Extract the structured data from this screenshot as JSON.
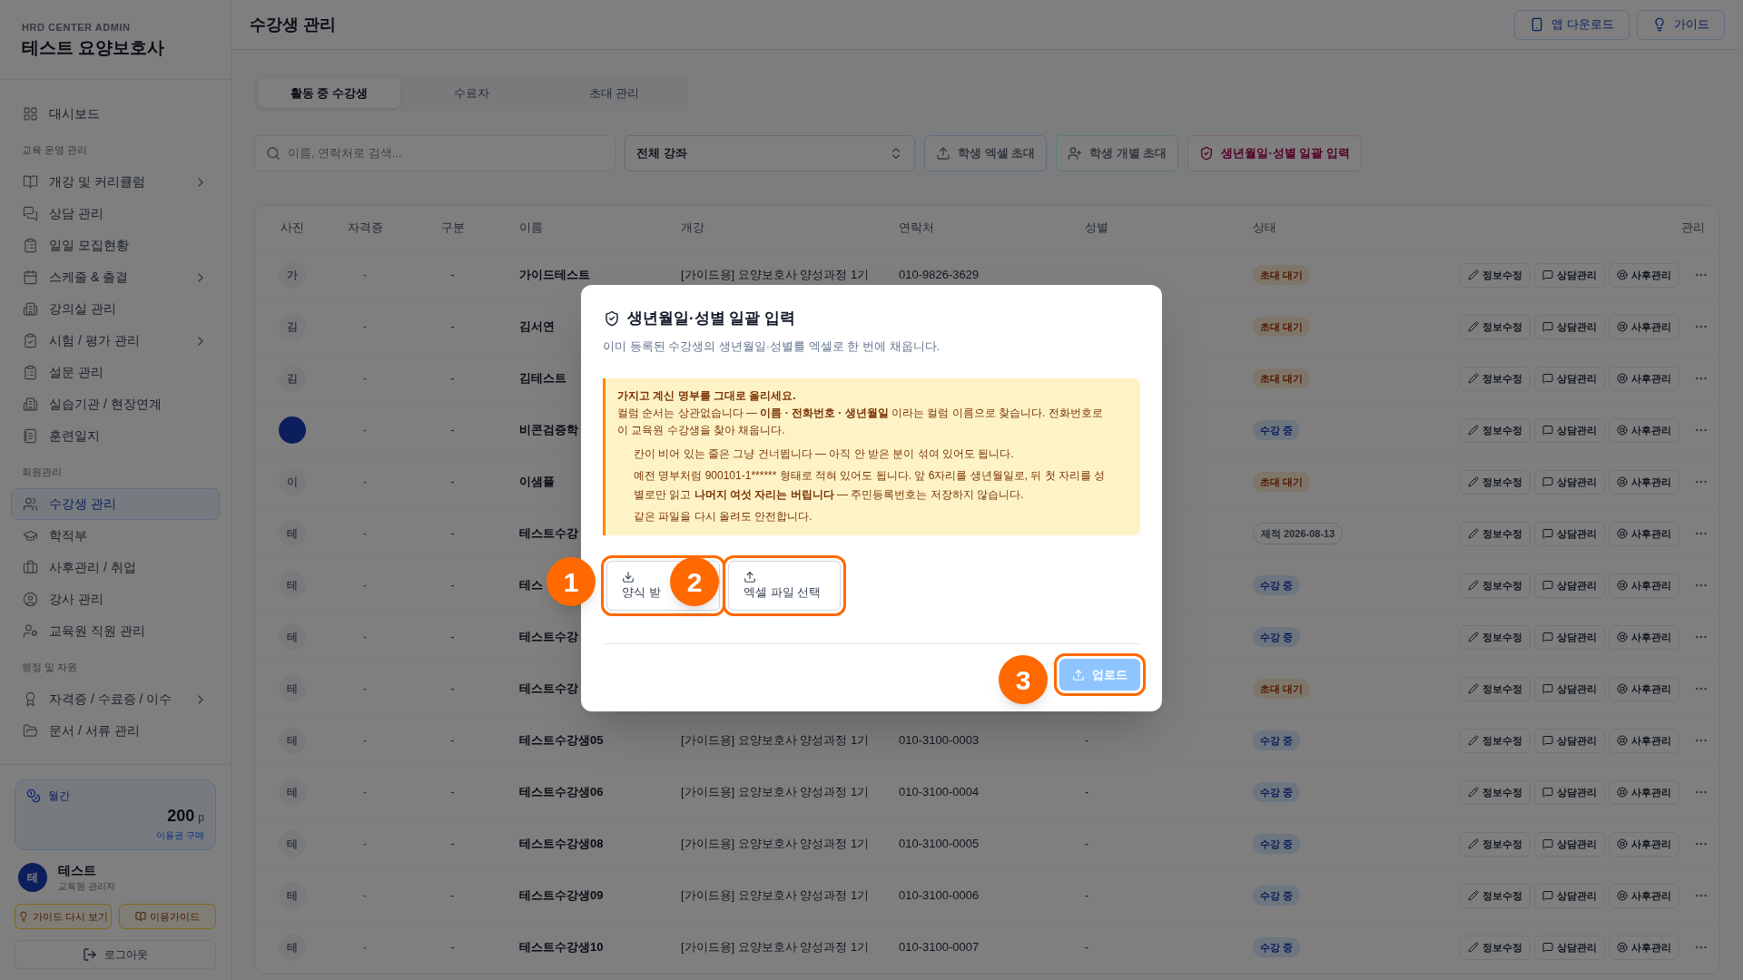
{
  "sidebar": {
    "brand_caption": "HRD CENTER ADMIN",
    "brand_title": "테스트 요양보호사",
    "sections": [
      {
        "items": [
          {
            "label": "대시보드",
            "expandable": false,
            "selected": false
          }
        ]
      },
      {
        "label": "교육 운영 관리",
        "items": [
          {
            "label": "개강 및 커리큘럼",
            "expandable": true,
            "selected": false
          },
          {
            "label": "상담 관리",
            "expandable": false,
            "selected": false
          },
          {
            "label": "일일 모집현황",
            "expandable": false,
            "selected": false
          },
          {
            "label": "스케줄 & 출결",
            "expandable": true,
            "selected": false
          },
          {
            "label": "강의실 관리",
            "expandable": false,
            "selected": false
          },
          {
            "label": "시험 / 평가 관리",
            "expandable": true,
            "selected": false
          },
          {
            "label": "설문 관리",
            "expandable": false,
            "selected": false
          },
          {
            "label": "실습기관 / 현장연계",
            "expandable": false,
            "selected": false
          },
          {
            "label": "훈련일지",
            "expandable": false,
            "selected": false
          }
        ]
      },
      {
        "label": "회원관리",
        "items": [
          {
            "label": "수강생 관리",
            "expandable": false,
            "selected": true
          },
          {
            "label": "학적부",
            "expandable": false,
            "selected": false
          },
          {
            "label": "사후관리 / 취업",
            "expandable": false,
            "selected": false
          },
          {
            "label": "강사 관리",
            "expandable": false,
            "selected": false
          },
          {
            "label": "교육원 직원 관리",
            "expandable": false,
            "selected": false
          }
        ]
      },
      {
        "label": "행정 및 자원",
        "items": [
          {
            "label": "자격증 / 수료증 / 이수",
            "expandable": true,
            "selected": false
          },
          {
            "label": "문서 / 서류 관리",
            "expandable": false,
            "selected": false
          }
        ]
      }
    ],
    "points": {
      "label": "월간",
      "amount": "200",
      "unit": "p",
      "link": "이용권 구매"
    },
    "user": {
      "initial": "테",
      "name": "테스트",
      "role": "교육원 관리자"
    },
    "guide_buttons": [
      "가이드 다시 보기",
      "이용가이드"
    ],
    "logout": "로그아웃"
  },
  "header": {
    "title": "수강생 관리",
    "buttons": [
      "앱 다운로드",
      "가이드"
    ]
  },
  "tabs": [
    {
      "label": "활동 중 수강생",
      "selected": true
    },
    {
      "label": "수료자",
      "selected": false
    },
    {
      "label": "초대 관리",
      "selected": false
    }
  ],
  "search": {
    "placeholder": "이름, 연락처로 검색..."
  },
  "course_select": {
    "value": "전체 강좌"
  },
  "toolbar_buttons": [
    {
      "label": "학생 엑셀 초대",
      "kind": "excel"
    },
    {
      "label": "학생 개별 초대",
      "kind": "single"
    },
    {
      "label": "생년월일·성별 일괄 입력",
      "kind": "bulk"
    }
  ],
  "table": {
    "columns": [
      "사진",
      "자격증",
      "구분",
      "이름",
      "개강",
      "연락처",
      "성별",
      "상태",
      "관리"
    ],
    "rows": [
      {
        "avatar": {
          "kind": "letter",
          "text": "가"
        },
        "license": "-",
        "type": "-",
        "name": "가이드테스트",
        "course": "[가이드용] 요양보호사 양성과정 1기",
        "phone": "010-9826-3629",
        "status": {
          "kind": "invited",
          "text": "초대 대기"
        },
        "actions": [
          "정보수정",
          "상담관리",
          "사후관리"
        ]
      },
      {
        "avatar": {
          "kind": "letter",
          "text": "김"
        },
        "license": "-",
        "type": "-",
        "name": "김서연",
        "status": {
          "kind": "invited",
          "text": "초대 대기"
        },
        "actions": [
          "정보수정",
          "상담관리",
          "사후관리"
        ]
      },
      {
        "avatar": {
          "kind": "letter",
          "text": "김"
        },
        "license": "-",
        "type": "-",
        "name": "김테스트",
        "status": {
          "kind": "invited",
          "text": "초대 대기"
        },
        "actions": [
          "정보수정",
          "상담관리",
          "사후관리"
        ]
      },
      {
        "avatar": {
          "kind": "photo"
        },
        "license": "-",
        "type": "-",
        "name": "비콘검증학",
        "status": {
          "kind": "active",
          "text": "수강 중"
        },
        "actions": [
          "정보수정",
          "상담관리",
          "사후관리"
        ]
      },
      {
        "avatar": {
          "kind": "letter",
          "text": "이"
        },
        "license": "-",
        "type": "-",
        "name": "이샘플",
        "status": {
          "kind": "invited",
          "text": "초대 대기"
        },
        "actions": [
          "정보수정",
          "상담관리",
          "사후관리"
        ]
      },
      {
        "avatar": {
          "kind": "letter",
          "text": "테"
        },
        "license": "-",
        "type": "-",
        "name": "테스트수강",
        "status": {
          "kind": "expelled",
          "text": "제적 2026-08-13"
        },
        "actions": [
          "정보수정",
          "상담관리",
          "사후관리"
        ]
      },
      {
        "avatar": {
          "kind": "letter",
          "text": "테"
        },
        "license": "-",
        "type": "-",
        "name": "테스",
        "status": {
          "kind": "active",
          "text": "수강 중"
        },
        "actions": [
          "정보수정",
          "상담관리",
          "사후관리"
        ]
      },
      {
        "avatar": {
          "kind": "letter",
          "text": "테"
        },
        "license": "-",
        "type": "-",
        "name": "테스트수강",
        "status": {
          "kind": "active",
          "text": "수강 중"
        },
        "actions": [
          "정보수정",
          "상담관리",
          "사후관리"
        ]
      },
      {
        "avatar": {
          "kind": "letter",
          "text": "테"
        },
        "license": "-",
        "type": "-",
        "name": "테스트수강",
        "status": {
          "kind": "invited",
          "text": "초대 대기"
        },
        "actions": [
          "정보수정",
          "상담관리",
          "사후관리"
        ]
      },
      {
        "avatar": {
          "kind": "letter",
          "text": "테"
        },
        "license": "-",
        "type": "-",
        "name": "테스트수강생05",
        "course": "[가이드용] 요양보호사 양성과정 1기",
        "phone": "010-3100-0003",
        "gender": "-",
        "status": {
          "kind": "active",
          "text": "수강 중"
        },
        "actions": [
          "정보수정",
          "상담관리",
          "사후관리"
        ]
      },
      {
        "avatar": {
          "kind": "letter",
          "text": "테"
        },
        "license": "-",
        "type": "-",
        "name": "테스트수강생06",
        "course": "[가이드용] 요양보호사 양성과정 1기",
        "phone": "010-3100-0004",
        "gender": "-",
        "status": {
          "kind": "active",
          "text": "수강 중"
        },
        "actions": [
          "정보수정",
          "상담관리",
          "사후관리"
        ]
      },
      {
        "avatar": {
          "kind": "letter",
          "text": "테"
        },
        "license": "-",
        "type": "-",
        "name": "테스트수강생08",
        "course": "[가이드용] 요양보호사 양성과정 1기",
        "phone": "010-3100-0005",
        "gender": "-",
        "status": {
          "kind": "active",
          "text": "수강 중"
        },
        "actions": [
          "정보수정",
          "상담관리",
          "사후관리"
        ]
      },
      {
        "avatar": {
          "kind": "letter",
          "text": "테"
        },
        "license": "-",
        "type": "-",
        "name": "테스트수강생09",
        "course": "[가이드용] 요양보호사 양성과정 1기",
        "phone": "010-3100-0006",
        "gender": "-",
        "status": {
          "kind": "active",
          "text": "수강 중"
        },
        "actions": [
          "정보수정",
          "상담관리",
          "사후관리"
        ]
      },
      {
        "avatar": {
          "kind": "letter",
          "text": "테"
        },
        "license": "-",
        "type": "-",
        "name": "테스트수강생10",
        "course": "[가이드용] 요양보호사 양성과정 1기",
        "phone": "010-3100-0007",
        "gender": "-",
        "status": {
          "kind": "active",
          "text": "수강 중"
        },
        "actions": [
          "정보수정",
          "상담관리",
          "사후관리"
        ]
      }
    ]
  },
  "modal": {
    "title": "생년월일·성별 일괄 입력",
    "description": "이미 등록된 수강생의 생년월일·성별를 엑셀로 한 번에 채웁니다.",
    "notice": {
      "heading": "가지고 계신 명부를 그대로 올리세요.",
      "body": "컬럼 순서는 상관없습니다 — **이름 · 전화번호 · 생년월일** 이라는 컬럼 이름으로 찾습니다. 전화번호로 이 교육원 수강생을 찾아 채웁니다.",
      "points": [
        [
          {
            "text": "칸이 비어 있는 줄은 그냥 건너뜁니다 — 아직 안 받은 분이 섞여 있어도 됩니다.",
            "bold": false
          }
        ],
        [
          {
            "text": "예전 명부처럼 900101-1****** 형태로 적혀 있어도 됩니다. 앞 6자리를 생년월일로, 뒤 첫 자리를 성별로만 읽고 ",
            "bold": false
          },
          {
            "text": "나머지 여섯 자리는 버립니다",
            "bold": true
          },
          {
            "text": " — 주민등록번호는 저장하지 않습니다.",
            "bold": false
          }
        ],
        [
          {
            "text": "같은 파일을 다시 올려도 안전합니다.",
            "bold": false
          }
        ]
      ]
    },
    "file_buttons": [
      {
        "label": "양식 받",
        "kind": "download",
        "highlighted": true
      },
      {
        "label": "엑셀 파일 선택",
        "kind": "upload",
        "highlighted": true
      }
    ],
    "upload_button": {
      "label": "업로드",
      "disabled": true,
      "highlighted": true
    }
  },
  "callouts": [
    "1",
    "2",
    "3"
  ]
}
